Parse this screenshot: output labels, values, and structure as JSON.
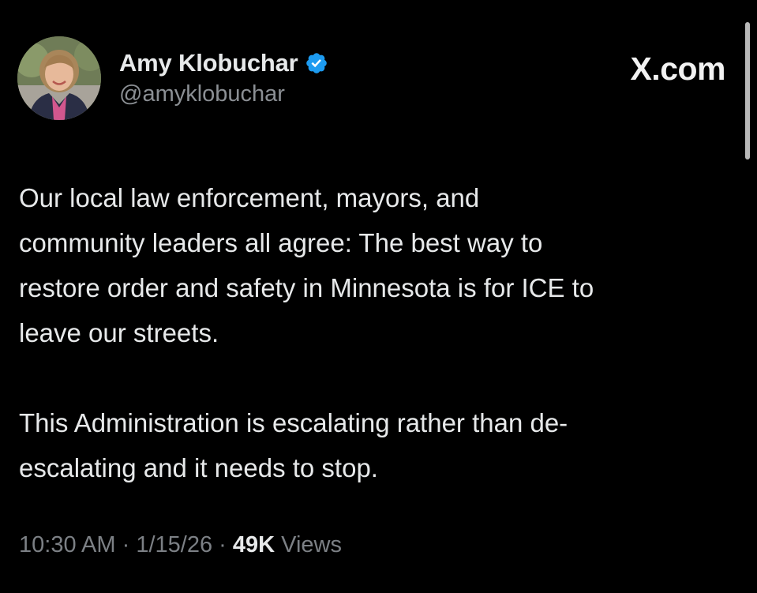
{
  "author": {
    "display_name": "Amy Klobuchar",
    "handle": "@amyklobuchar",
    "verified": true,
    "verified_badge_color": "#1d9bf0"
  },
  "site_label": "X.com",
  "tweet": {
    "paragraphs": [
      "Our local law enforcement, mayors, and\ncommunity leaders all agree: The best way to\nrestore order and safety in Minnesota is for ICE to\nleave our streets.",
      "This Administration is escalating rather than de-\nescalating and it needs to stop."
    ]
  },
  "meta": {
    "time": "10:30 AM",
    "separator": "·",
    "date": "1/15/26",
    "views_count": "49K",
    "views_label": "Views"
  },
  "icons": {
    "verified": "verified-badge-icon",
    "avatar": "profile-photo"
  },
  "colors": {
    "background": "#000000",
    "primary_text": "#e7e9ea",
    "secondary_text": "#8b8f94"
  }
}
